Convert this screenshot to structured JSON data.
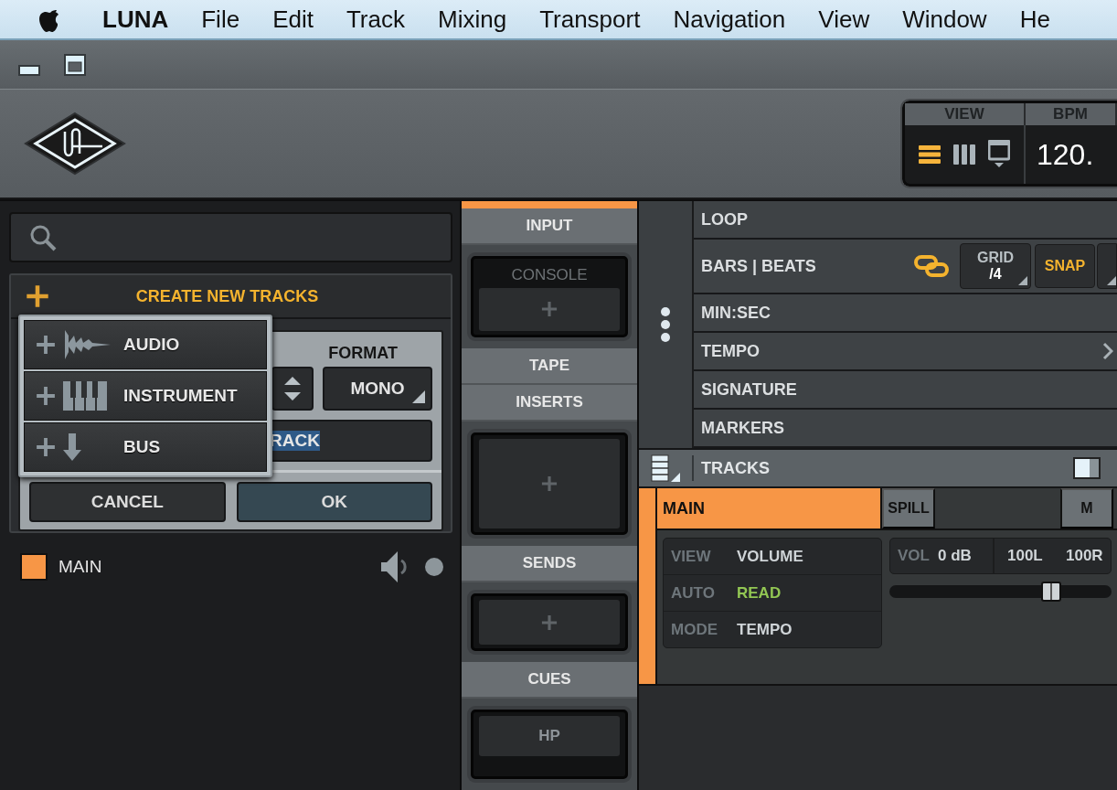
{
  "menu_bar": {
    "app": "LUNA",
    "items": [
      "File",
      "Edit",
      "Track",
      "Mixing",
      "Transport",
      "Navigation",
      "View",
      "Window",
      "He"
    ]
  },
  "header": {
    "view_label": "VIEW",
    "view_modes": [
      {
        "kind": "rows",
        "selected": true
      },
      {
        "kind": "columns",
        "selected": false
      },
      {
        "kind": "screen",
        "selected": false
      }
    ],
    "bpm_label": "BPM",
    "bpm_value": "120."
  },
  "create_tracks": {
    "title": "CREATE NEW TRACKS",
    "format_label": "FORMAT",
    "format_value": "MONO",
    "name_value": "RACK",
    "cancel": "CANCEL",
    "ok": "OK",
    "menu": [
      {
        "kind": "audio",
        "label": "AUDIO"
      },
      {
        "kind": "instrument",
        "label": "INSTRUMENT"
      },
      {
        "kind": "bus",
        "label": "BUS"
      }
    ]
  },
  "track_list": [
    {
      "name": "MAIN",
      "color": "#f79646"
    }
  ],
  "channel_strip": {
    "color": "#f79646",
    "sections": [
      {
        "title": "INPUT",
        "slot": {
          "kind": "console",
          "label": "CONSOLE"
        }
      },
      {
        "title": "TAPE"
      },
      {
        "title": "INSERTS",
        "slot": {
          "kind": "add_tall"
        }
      },
      {
        "title": "SENDS",
        "slot": {
          "kind": "add"
        }
      },
      {
        "title": "CUES",
        "slot": {
          "kind": "label",
          "label": "HP"
        }
      }
    ]
  },
  "rulers": [
    {
      "kind": "plain",
      "label": "LOOP"
    },
    {
      "kind": "timebase",
      "label": "BARS | BEATS",
      "grid_label": "GRID",
      "grid_value": "/4",
      "snap_label": "SNAP",
      "snap_on": true
    },
    {
      "kind": "plain",
      "label": "MIN:SEC"
    },
    {
      "kind": "expandable",
      "label": "TEMPO"
    },
    {
      "kind": "plain",
      "label": "SIGNATURE"
    },
    {
      "kind": "plain",
      "label": "MARKERS"
    }
  ],
  "tracks_bar": {
    "title": "TRACKS"
  },
  "track": {
    "name": "MAIN",
    "color": "#f79646",
    "spill": "SPILL",
    "mute": "M",
    "info": [
      {
        "kind": "normal",
        "label": "VIEW",
        "value": "VOLUME"
      },
      {
        "kind": "auto",
        "label": "AUTO",
        "value": "READ"
      },
      {
        "kind": "normal",
        "label": "MODE",
        "value": "TEMPO"
      }
    ],
    "volume": {
      "label": "VOL",
      "value": "0 dB",
      "pan_left": "100L",
      "pan_right": "100R",
      "level": 0.75
    }
  }
}
